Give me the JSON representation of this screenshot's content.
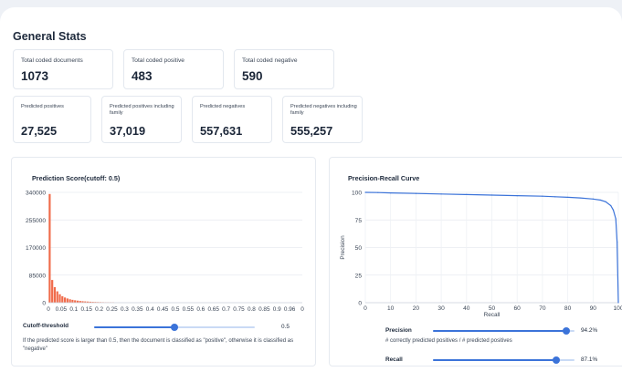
{
  "page_title": "General Stats",
  "row1": [
    {
      "label": "Total coded documents",
      "value": "1073"
    },
    {
      "label": "Total coded positive",
      "value": "483"
    },
    {
      "label": "Total coded negative",
      "value": "590"
    }
  ],
  "row2": [
    {
      "label": "Predicted positives",
      "value": "27,525"
    },
    {
      "label": "Predicted positives including family",
      "value": "37,019"
    },
    {
      "label": "Predicted negatives",
      "value": "557,631"
    },
    {
      "label": "Predicted negatives including family",
      "value": "555,257"
    }
  ],
  "prediction_chart": {
    "title": "Prediction Score(cutoff: 0.5)",
    "bar_color": "#f06b4b",
    "cutoff": {
      "label": "Cutoff-threshold",
      "value": "0.5",
      "fraction": 0.5
    },
    "note": "If the predicted score is larger than 0.5, then the document is classified as \"positive\", otherwise it is classified as \"negative\""
  },
  "pr_chart": {
    "title": "Precision-Recall Curve",
    "line_color": "#3b73d9",
    "precision": {
      "label": "Precision",
      "value": "94.2%",
      "fraction": 0.942,
      "desc": "# correctly predicted positives / # predicted positives"
    },
    "recall": {
      "label": "Recall",
      "value": "87.1%",
      "fraction": 0.871
    }
  },
  "chart_data": [
    {
      "type": "bar",
      "title": "Prediction Score(cutoff: 0.5)",
      "xlabel": "",
      "ylabel": "",
      "ylim": [
        0,
        340000
      ],
      "yticks": [
        "0",
        "85000",
        "170000",
        "255000",
        "340000"
      ],
      "xticks": [
        "0",
        "0.05",
        "0.1",
        "0.15",
        "0.2",
        "0.25",
        "0.3",
        "0.35",
        "0.4",
        "0.45",
        "0.5",
        "0.55",
        "0.6",
        "0.65",
        "0.7",
        "0.75",
        "0.8",
        "0.85",
        "0.9",
        "0.96",
        "0"
      ],
      "categories": [
        "0.00",
        "0.01",
        "0.02",
        "0.03",
        "0.04",
        "0.05",
        "0.06",
        "0.07",
        "0.08",
        "0.09",
        "0.10",
        "0.11",
        "0.12",
        "0.13",
        "0.14",
        "0.15",
        "0.16",
        "0.17",
        "0.18",
        "0.19",
        "0.20",
        "0.21",
        "0.22",
        "0.23",
        "0.24",
        "0.25"
      ],
      "values": [
        335000,
        70000,
        48000,
        35000,
        26000,
        20000,
        16000,
        13000,
        10500,
        8800,
        7400,
        6300,
        5400,
        4600,
        4000,
        3500,
        3000,
        2600,
        2300,
        2000,
        1800,
        1600,
        1400,
        1300,
        1200,
        1100
      ],
      "grid": true
    },
    {
      "type": "line",
      "title": "Precision-Recall Curve",
      "xlabel": "Recall",
      "ylabel": "Precision",
      "xlim": [
        0,
        100
      ],
      "ylim": [
        0,
        100
      ],
      "xticks": [
        "0",
        "10",
        "20",
        "30",
        "40",
        "50",
        "60",
        "70",
        "80",
        "90",
        "100"
      ],
      "yticks": [
        "0",
        "25",
        "50",
        "75",
        "100"
      ],
      "series": [
        {
          "x": [
            0,
            5,
            10,
            20,
            30,
            40,
            50,
            60,
            70,
            75,
            80,
            85,
            90,
            93,
            95,
            97,
            98,
            99,
            99.5,
            100
          ],
          "y": [
            100,
            99.8,
            99.5,
            99,
            98.5,
            98,
            97.5,
            97,
            96.5,
            96,
            95.5,
            95,
            94,
            93,
            91.5,
            88,
            84,
            76,
            55,
            0
          ]
        }
      ],
      "grid": true
    }
  ]
}
